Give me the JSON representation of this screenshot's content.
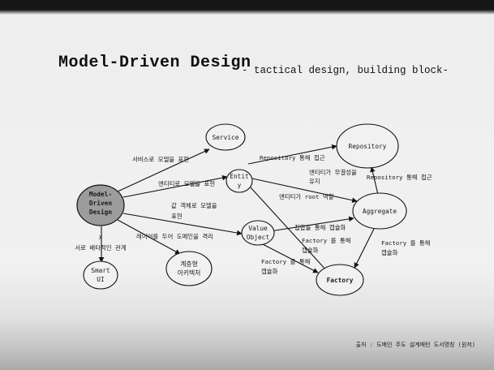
{
  "title": "Model-Driven Design",
  "subtitle": "- tactical design, building block-",
  "nodes": {
    "model_driven_design": [
      "Model-",
      "Driven",
      "Design"
    ],
    "service": [
      "Service"
    ],
    "entity": [
      "Entit",
      "y"
    ],
    "value_object": [
      "Value",
      "Object"
    ],
    "repository": [
      "Repository"
    ],
    "aggregate": [
      "Aggregate"
    ],
    "factory": [
      "Factory"
    ],
    "smart_ui": [
      "Smart",
      "UI"
    ],
    "layered_architecture": [
      "계층형",
      "아키텍처"
    ]
  },
  "edges": {
    "mdd_to_service": [
      "서비스로 모델을 표현"
    ],
    "mdd_to_entity": [
      "엔티티로 모델을 표현"
    ],
    "mdd_to_value_object": [
      "값 객체로 모델을",
      "표현"
    ],
    "mdd_to_layered": [
      "레이어를 두어 도메인을 격리"
    ],
    "mdd_to_smart_ui": [
      "X",
      "서로 배타적인 관계"
    ],
    "entity_to_repository": [
      "Repository 통해 접근"
    ],
    "entity_integrity": [
      "엔티티가 무결성을",
      "유지"
    ],
    "entity_root": [
      "엔티티가 root 역할"
    ],
    "aggregate_to_repository": [
      "Repository 통해 접근"
    ],
    "vo_to_aggregate": [
      "집합을 통해 캡슐화"
    ],
    "vo_factory_mid": [
      "Factory 를 통해",
      "캡슐화"
    ],
    "vo_to_factory": [
      "Factory 를 통해",
      "캡슐화"
    ],
    "aggregate_to_factory": [
      "Factory 를 통해",
      "캡슐화"
    ]
  },
  "footer": "출처 : 도메인 주도 설계패턴 도서명칭 (원저)",
  "colors": {
    "background": "#efefef",
    "ink": "#111111",
    "highlight_node_fill": "#9c9c9c"
  }
}
